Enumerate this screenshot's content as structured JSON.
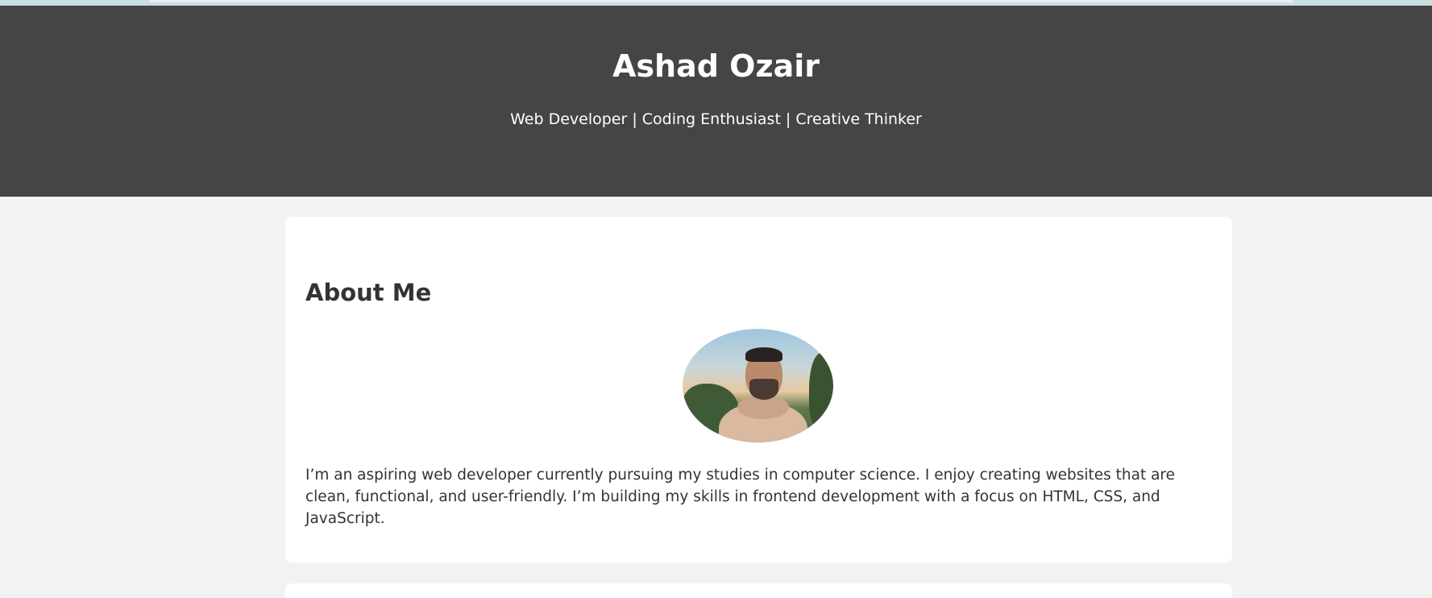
{
  "header": {
    "name": "Ashad Ozair",
    "tagline": "Web Developer | Coding Enthusiast | Creative Thinker"
  },
  "about": {
    "heading": "About Me",
    "photo_icon": "profile-photo",
    "bio": "I’m an aspiring web developer currently pursuing my studies in computer science. I enjoy creating websites that are clean, functional, and user-friendly. I’m building my skills in frontend development with a focus on HTML, CSS, and JavaScript."
  },
  "colors": {
    "header_bg": "#454545",
    "page_bg": "#f2f2f2",
    "card_bg": "#ffffff",
    "text": "#333333"
  }
}
